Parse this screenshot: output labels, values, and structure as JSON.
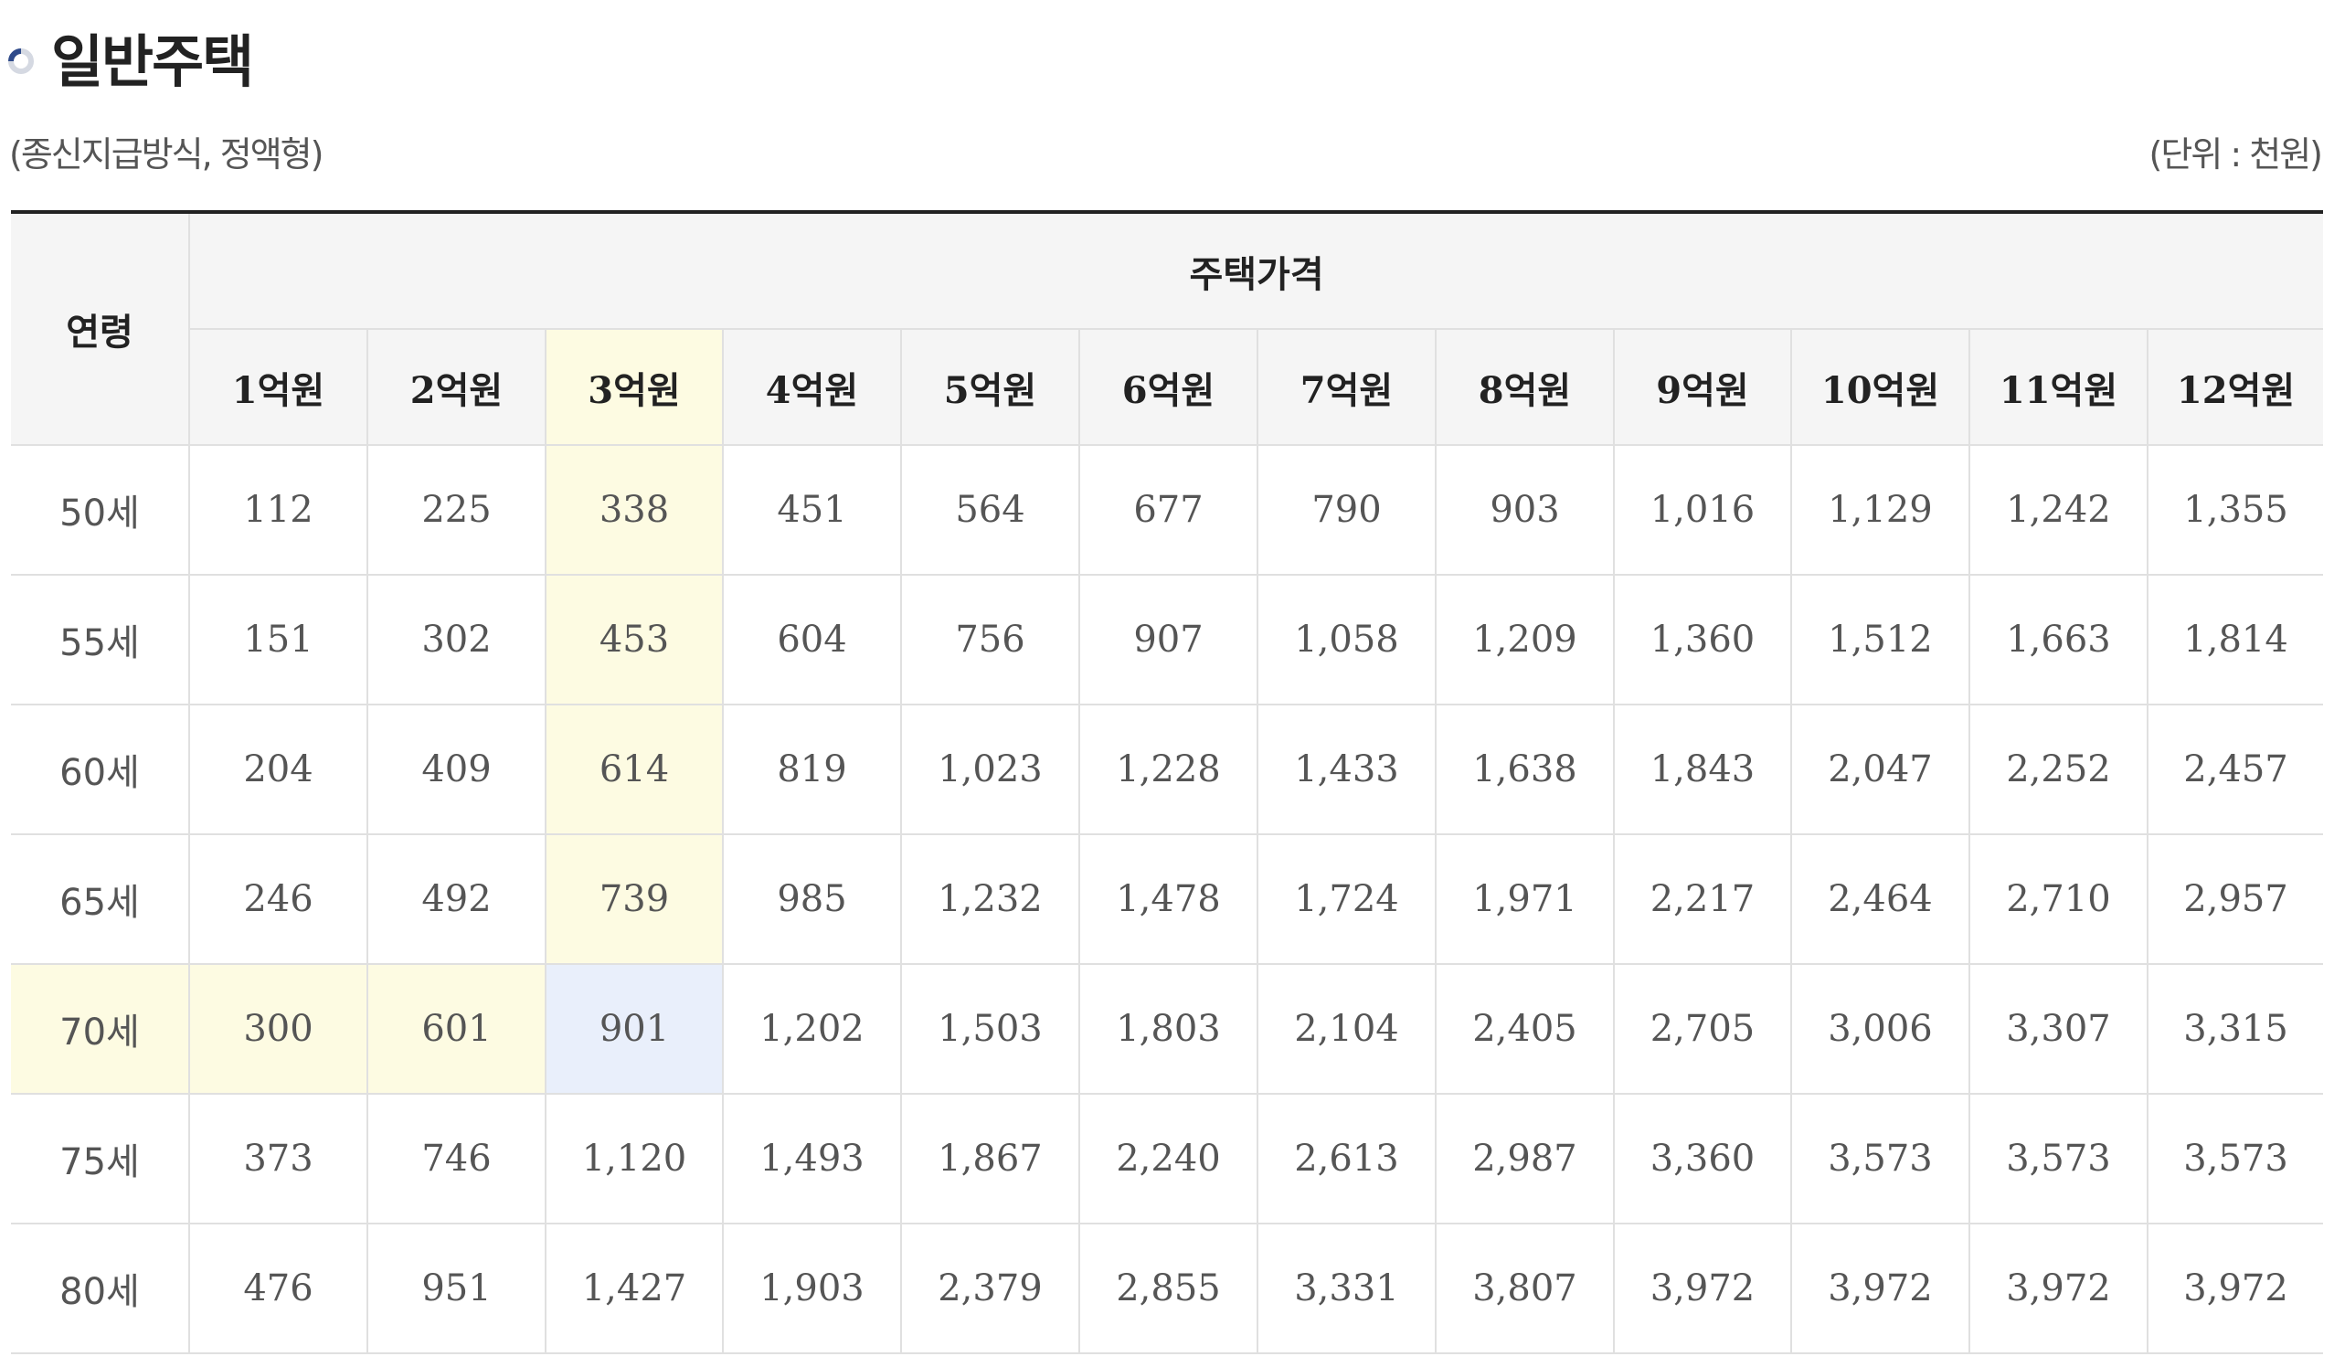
{
  "title": "일반주택",
  "subtitle_left": "(종신지급방식, 정액형)",
  "subtitle_right": "(단위 : 천원)",
  "table": {
    "age_header": "연령",
    "price_header": "주택가격",
    "columns": [
      "1억원",
      "2억원",
      "3억원",
      "4억원",
      "5억원",
      "6억원",
      "7억원",
      "8억원",
      "9억원",
      "10억원",
      "11억원",
      "12억원"
    ],
    "rows": [
      {
        "age": "50세",
        "values": [
          "112",
          "225",
          "338",
          "451",
          "564",
          "677",
          "790",
          "903",
          "1,016",
          "1,129",
          "1,242",
          "1,355"
        ]
      },
      {
        "age": "55세",
        "values": [
          "151",
          "302",
          "453",
          "604",
          "756",
          "907",
          "1,058",
          "1,209",
          "1,360",
          "1,512",
          "1,663",
          "1,814"
        ]
      },
      {
        "age": "60세",
        "values": [
          "204",
          "409",
          "614",
          "819",
          "1,023",
          "1,228",
          "1,433",
          "1,638",
          "1,843",
          "2,047",
          "2,252",
          "2,457"
        ]
      },
      {
        "age": "65세",
        "values": [
          "246",
          "492",
          "739",
          "985",
          "1,232",
          "1,478",
          "1,724",
          "1,971",
          "2,217",
          "2,464",
          "2,710",
          "2,957"
        ]
      },
      {
        "age": "70세",
        "values": [
          "300",
          "601",
          "901",
          "1,202",
          "1,503",
          "1,803",
          "2,104",
          "2,405",
          "2,705",
          "3,006",
          "3,307",
          "3,315"
        ]
      },
      {
        "age": "75세",
        "values": [
          "373",
          "746",
          "1,120",
          "1,493",
          "1,867",
          "2,240",
          "2,613",
          "2,987",
          "3,360",
          "3,573",
          "3,573",
          "3,573"
        ]
      },
      {
        "age": "80세",
        "values": [
          "476",
          "951",
          "1,427",
          "1,903",
          "2,379",
          "2,855",
          "3,331",
          "3,807",
          "3,972",
          "3,972",
          "3,972",
          "3,972"
        ]
      }
    ],
    "highlight": {
      "column_color": "#fdfbe2",
      "row_color": "#fdfbe2",
      "intersection_color": "#e9effb"
    }
  }
}
